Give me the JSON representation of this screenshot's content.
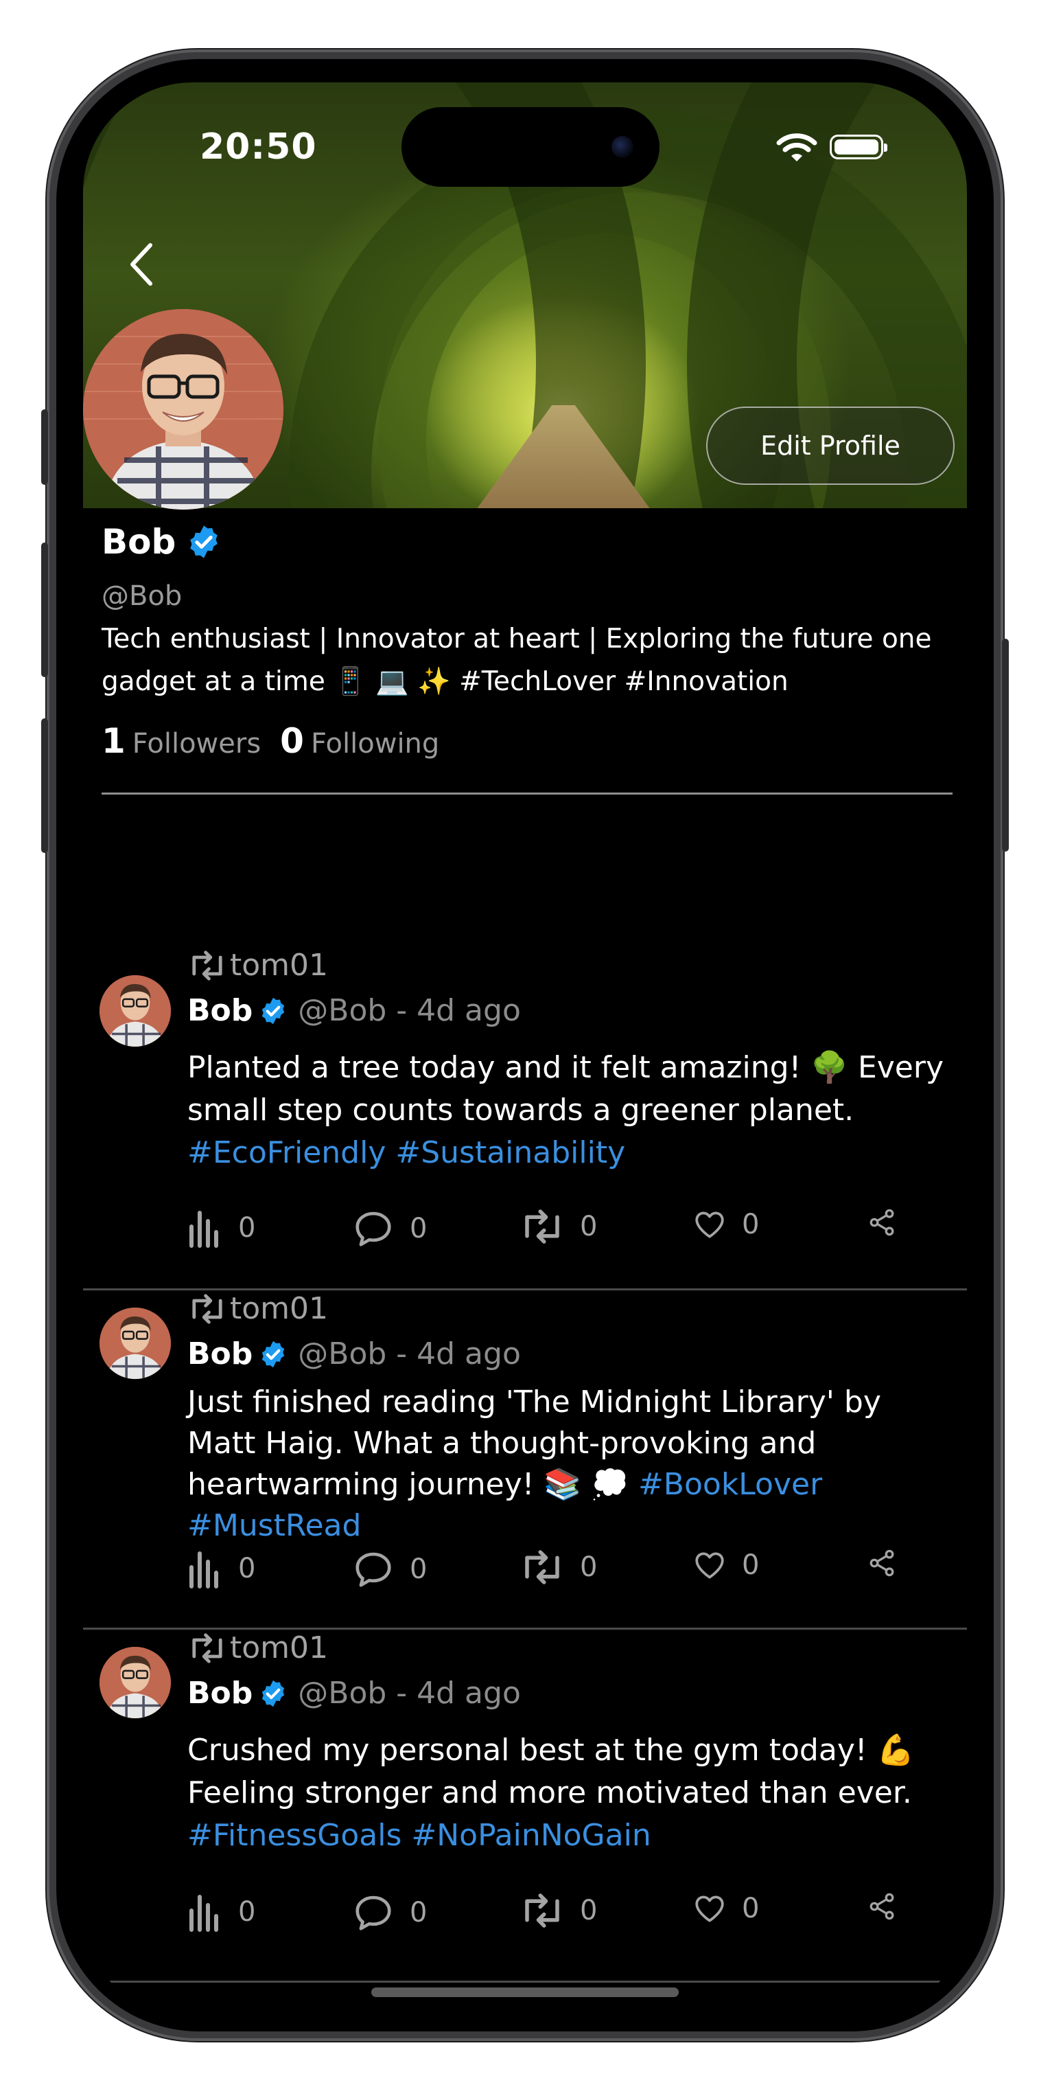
{
  "status_bar": {
    "time": "20:50"
  },
  "header": {
    "edit_profile_label": "Edit Profile"
  },
  "profile": {
    "name": "Bob",
    "handle": "@Bob",
    "bio": "Tech enthusiast | Innovator at heart | Exploring the future one gadget at a time 📱 💻 ✨  #TechLover #Innovation",
    "followers_count": "1",
    "followers_label": "Followers",
    "following_count": "0",
    "following_label": "Following"
  },
  "posts": [
    {
      "reposted_by": "tom01",
      "author": "Bob",
      "meta": "@Bob - 4d ago",
      "text": "Planted a tree today and it felt amazing! 🌳  Every small step counts towards a greener planet.",
      "hashtags": "#EcoFriendly #Sustainability",
      "views": "0",
      "comments": "0",
      "reposts": "0",
      "likes": "0"
    },
    {
      "reposted_by": "tom01",
      "author": "Bob",
      "meta": "@Bob - 4d ago",
      "text": "Just finished reading 'The Midnight Library' by Matt Haig. What a thought-provoking and heartwarming journey! 📚 💭 ",
      "hashtags": "#BookLover #MustRead",
      "views": "0",
      "comments": "0",
      "reposts": "0",
      "likes": "0"
    },
    {
      "reposted_by": "tom01",
      "author": "Bob",
      "meta": "@Bob - 4d ago",
      "text": "Crushed my personal best at the gym today! 💪 Feeling stronger and more motivated than ever.",
      "hashtags": "#FitnessGoals #NoPainNoGain",
      "views": "0",
      "comments": "0",
      "reposts": "0",
      "likes": "0"
    }
  ],
  "colors": {
    "background": "#000000",
    "hashtag": "#3b8fe0",
    "verified": "#1d9bf0",
    "secondary_text": "#9a9a9a"
  }
}
